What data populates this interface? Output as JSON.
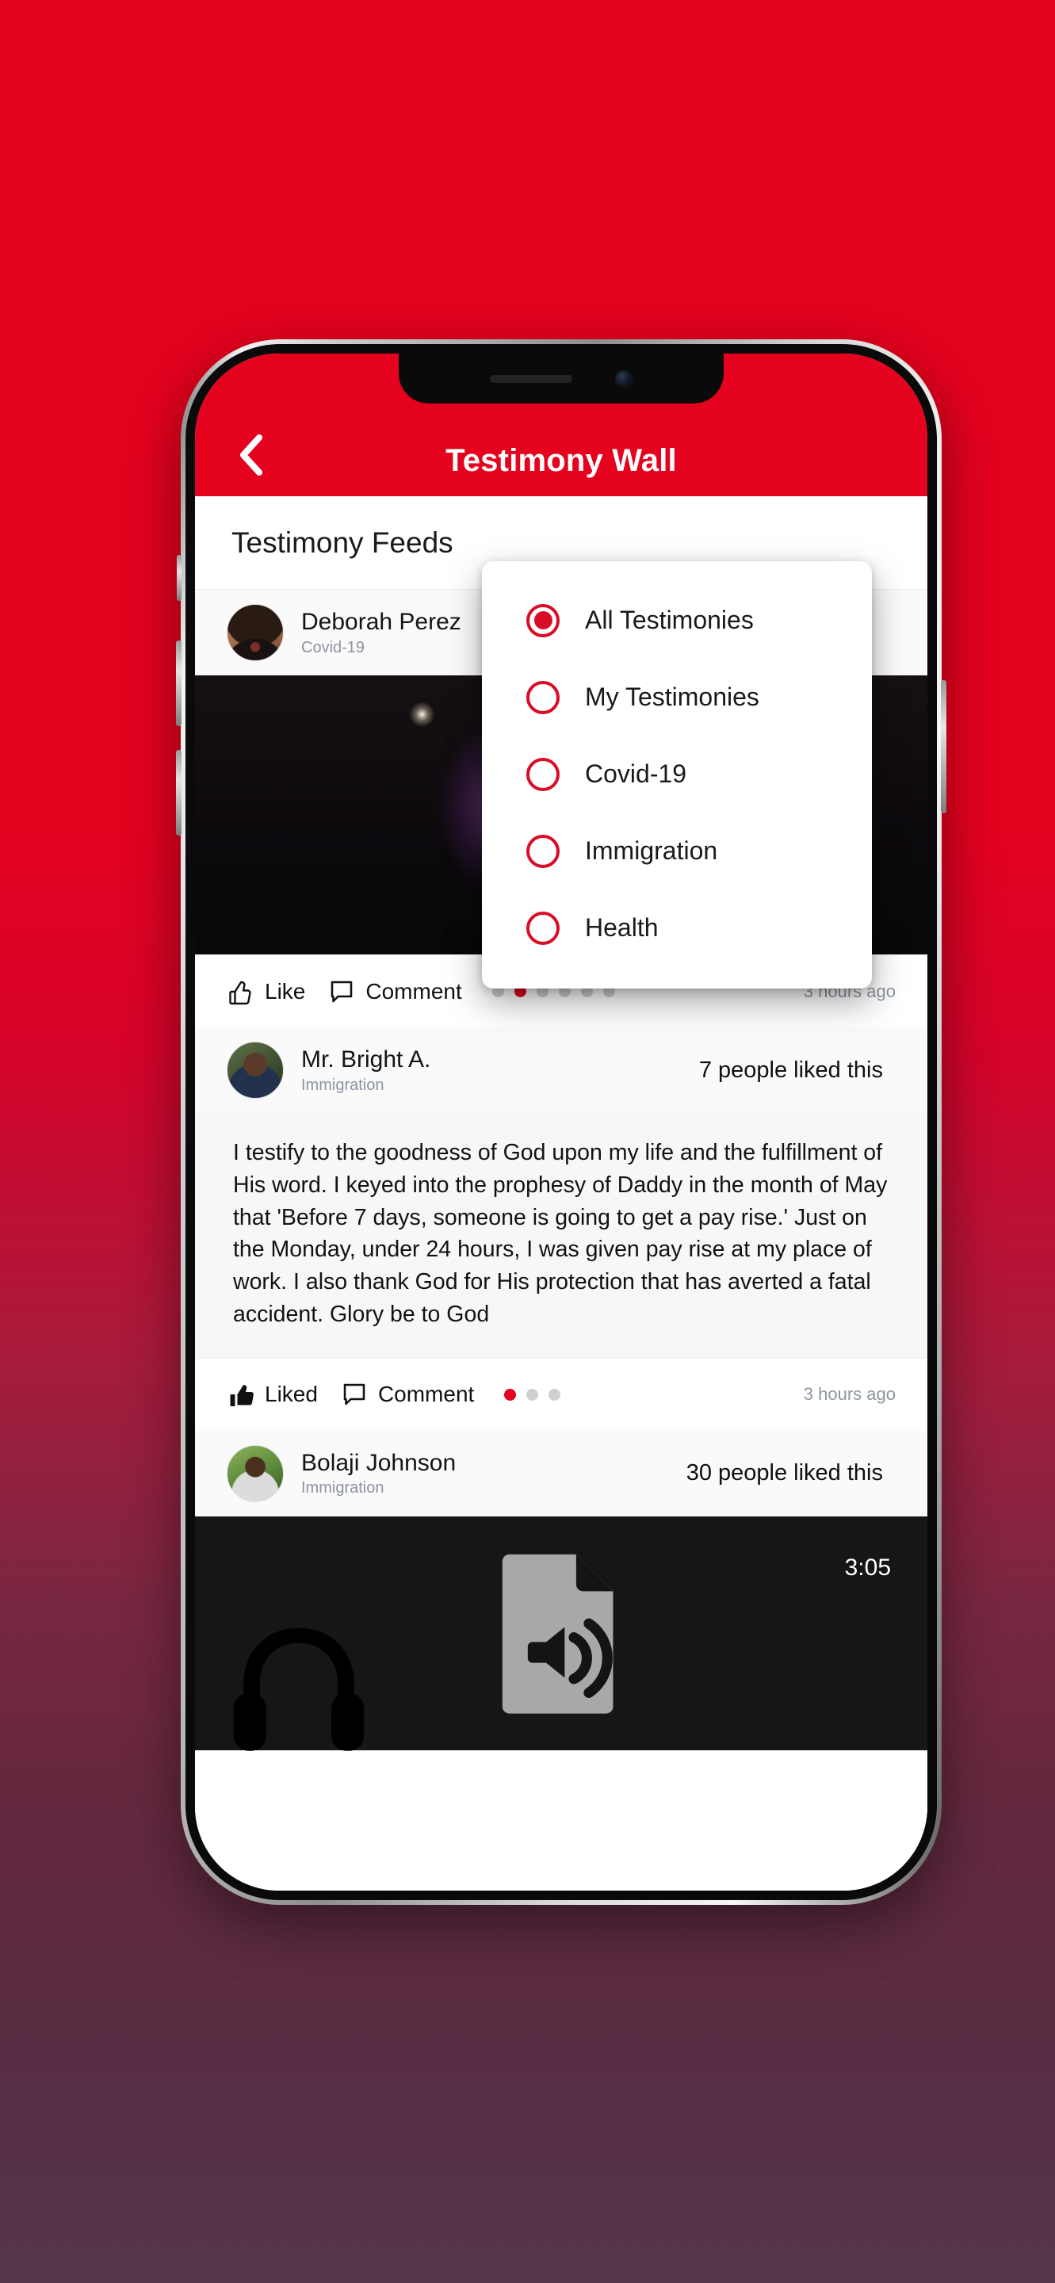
{
  "theme": {
    "brand_red": "#e4021e",
    "accent_red": "#d80d27",
    "page_bg_top": "#e4021e",
    "page_bg_bottom": "#56374c"
  },
  "header": {
    "title": "Testimony Wall",
    "back_icon": "chevron-left-icon"
  },
  "feeds": {
    "section_title": "Testimony Feeds"
  },
  "dropdown": {
    "selected": "All Testimonies",
    "options": [
      {
        "label": "All Testimonies",
        "selected": true
      },
      {
        "label": "My Testimonies",
        "selected": false
      },
      {
        "label": "Covid-19",
        "selected": false
      },
      {
        "label": "Immigration",
        "selected": false
      },
      {
        "label": "Health",
        "selected": false
      }
    ]
  },
  "posts": [
    {
      "author": "Deborah Perez",
      "tag": "Covid-19",
      "likes_text": "",
      "media_type": "video",
      "actions": {
        "like_label": "Like",
        "comment_label": "Comment",
        "liked": false,
        "dots_total": 6,
        "dots_active_index": 1,
        "timestamp": "3 hours ago"
      }
    },
    {
      "author": "Mr. Bright A.",
      "tag": "Immigration",
      "likes_text": "7 people liked this",
      "media_type": "text",
      "body": " I testify to the goodness of God upon my life and the fulfillment of His word. I keyed into the prophesy of Daddy in the month of May that 'Before 7 days, someone is going to get a pay rise.' Just on the Monday, under 24 hours, I was given pay rise at my place of work. I also thank God for His protection that has averted a fatal accident. Glory be to God",
      "actions": {
        "like_label": "Liked",
        "comment_label": "Comment",
        "liked": true,
        "dots_total": 3,
        "dots_active_index": 0,
        "timestamp": "3 hours ago"
      }
    },
    {
      "author": "Bolaji Johnson",
      "tag": "Immigration",
      "likes_text": "30 people liked this",
      "media_type": "audio",
      "audio_duration": "3:05"
    }
  ]
}
